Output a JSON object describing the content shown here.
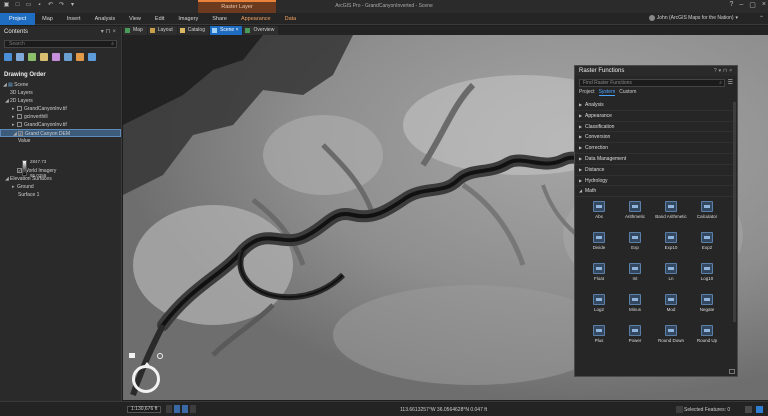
{
  "titlebar": {
    "title": "ArcGIS Pro - GrandCanyonInverted - Scene",
    "context_tab": "Raster Layer"
  },
  "ribbon": {
    "tabs": [
      "Project",
      "Map",
      "Insert",
      "Analysis",
      "View",
      "Edit",
      "Imagery",
      "Share",
      "Appearance",
      "Data"
    ],
    "user": "John (ArcGIS Maps for the Nation)"
  },
  "contents": {
    "title": "Contents",
    "search_placeholder": "Search",
    "drawing_order": "Drawing Order",
    "tree": {
      "scene": "Scene",
      "layers_3d": "3D Layers",
      "layers_2d": "2D Layers",
      "layer1": "GrandCanyonInv.tif",
      "layer2": "gcinverthill",
      "layer3": "GrandCanyonInv.tif",
      "layer4": "Grand Canyon DEM",
      "value_label": "Value",
      "value_high": "2847.73",
      "value_low": "95.0258",
      "world_imagery": "World Imagery",
      "elevation": "Elevation Surfaces",
      "ground": "Ground",
      "surface": "Surface 1"
    }
  },
  "viewtabs": [
    "Map",
    "Layout",
    "Catalog",
    "Scene",
    "Overview"
  ],
  "raster_functions": {
    "title": "Raster Functions",
    "find_placeholder": "Find Raster Functions",
    "subtabs": [
      "Project",
      "System",
      "Custom"
    ],
    "categories": [
      "Analysis",
      "Appearance",
      "Classification",
      "Conversion",
      "Correction",
      "Data Management",
      "Distance",
      "Hydrology",
      "Math"
    ],
    "functions": [
      "Abs",
      "Arithmetic",
      "Band Arithmetic",
      "Calculator",
      "Divide",
      "Exp",
      "Exp10",
      "Exp2",
      "Float",
      "Int",
      "Ln",
      "Log10",
      "Log2",
      "Minus",
      "Mod",
      "Negate",
      "Plus",
      "Power",
      "Round Down",
      "Round Up"
    ]
  },
  "status": {
    "scale": "1:130,676 ft",
    "coords": "113.6613257°W 36.0564628°N  0.047 ft",
    "selected": "Selected Features: 0"
  }
}
